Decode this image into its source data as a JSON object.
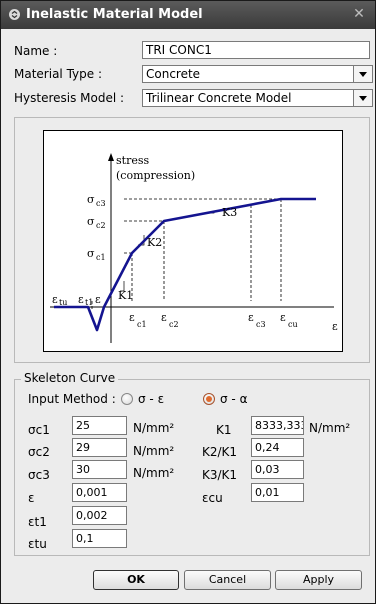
{
  "window": {
    "title": "Inelastic Material Model",
    "close_glyph": "✕",
    "icon": "chevron-circle-icon"
  },
  "form": {
    "name_label": "Name :",
    "name_value": "TRI CONC1",
    "material_type_label": "Material Type :",
    "material_type_value": "Concrete",
    "hysteresis_label": "Hysteresis Model :",
    "hysteresis_value": "Trilinear Concrete Model"
  },
  "diagram": {
    "stress_label": "stress",
    "compression_label": "(compression)",
    "sigma": "σ",
    "epsilon": "ε",
    "sub_c3": "c3",
    "sub_c2": "c2",
    "sub_c1": "c1",
    "sub_tu": "tu",
    "sub_t1": "t1",
    "sub_cu": "cu",
    "k1": "K1",
    "k2": "K2",
    "k3": "K3"
  },
  "skeleton": {
    "group_title": "Skeleton Curve",
    "input_method_label": "Input Method :",
    "option1": "σ - ε",
    "option2": "σ - α",
    "selected_option": 2,
    "sc1_label": "σc1",
    "sc1_value": "25",
    "sc2_label": "σc2",
    "sc2_value": "29",
    "sc3_label": "σc3",
    "sc3_value": "30",
    "eps_label": "ε",
    "eps_value": "0,001",
    "et1_label": "εt1",
    "et1_value": "0,002",
    "etu_label": "εtu",
    "etu_value": "0,1",
    "stress_unit": "N/mm²",
    "k1_label": "K1",
    "k1_value": "8333,3333",
    "k2k1_label": "K2/K1",
    "k2k1_value": "0,24",
    "k3k1_label": "K3/K1",
    "k3k1_value": "0,03",
    "ecu_label": "εcu",
    "ecu_value": "0,01"
  },
  "buttons": {
    "ok": "OK",
    "cancel": "Cancel",
    "apply": "Apply"
  },
  "colors": {
    "curve": "#141490",
    "accent_radio": "#e06b2e",
    "titlebar": "#454545"
  }
}
